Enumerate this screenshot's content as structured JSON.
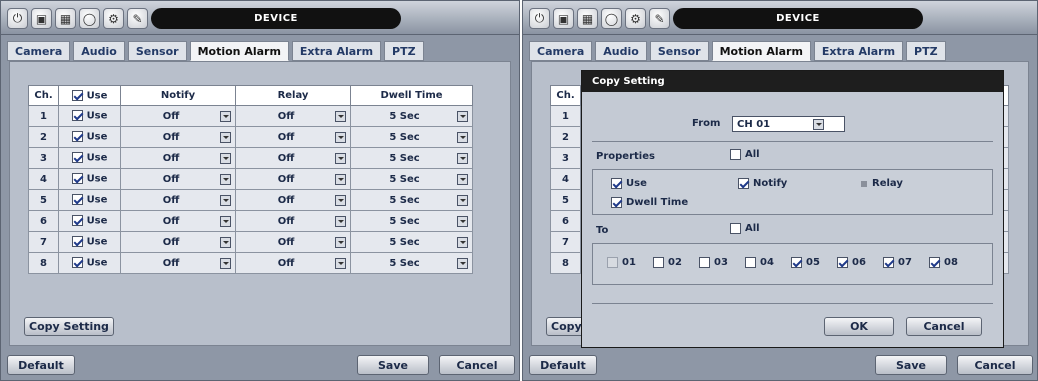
{
  "window_title": "DEVICE",
  "tabs": [
    "Camera",
    "Audio",
    "Sensor",
    "Motion Alarm",
    "Extra Alarm",
    "PTZ"
  ],
  "active_tab": "Motion Alarm",
  "table": {
    "headers": {
      "ch": "Ch.",
      "use": "Use",
      "notify": "Notify",
      "relay": "Relay",
      "dwell": "Dwell Time"
    },
    "rows": [
      {
        "ch": "1",
        "use": "Use",
        "notify": "Off",
        "relay": "Off",
        "dwell": "5 Sec"
      },
      {
        "ch": "2",
        "use": "Use",
        "notify": "Off",
        "relay": "Off",
        "dwell": "5 Sec"
      },
      {
        "ch": "3",
        "use": "Use",
        "notify": "Off",
        "relay": "Off",
        "dwell": "5 Sec"
      },
      {
        "ch": "4",
        "use": "Use",
        "notify": "Off",
        "relay": "Off",
        "dwell": "5 Sec"
      },
      {
        "ch": "5",
        "use": "Use",
        "notify": "Off",
        "relay": "Off",
        "dwell": "5 Sec"
      },
      {
        "ch": "6",
        "use": "Use",
        "notify": "Off",
        "relay": "Off",
        "dwell": "5 Sec"
      },
      {
        "ch": "7",
        "use": "Use",
        "notify": "Off",
        "relay": "Off",
        "dwell": "5 Sec"
      },
      {
        "ch": "8",
        "use": "Use",
        "notify": "Off",
        "relay": "Off",
        "dwell": "5 Sec"
      }
    ]
  },
  "copy_setting_button": "Copy Setting",
  "bottom": {
    "default": "Default",
    "save": "Save",
    "cancel": "Cancel"
  },
  "right_rows": [
    "1",
    "2",
    "3",
    "4",
    "5",
    "6",
    "7",
    "8"
  ],
  "dialog": {
    "title": "Copy Setting",
    "from_label": "From",
    "from_value": "CH 01",
    "properties_label": "Properties",
    "all_label": "All",
    "use": "Use",
    "notify": "Notify",
    "relay": "Relay",
    "dwell_time": "Dwell Time",
    "to_label": "To",
    "channels": [
      "01",
      "02",
      "03",
      "04",
      "05",
      "06",
      "07",
      "08"
    ],
    "ok": "OK",
    "cancel": "Cancel"
  },
  "colors": {
    "accent": "#1c2a48",
    "panel": "#8e97a6",
    "titlebar": "#111111"
  }
}
